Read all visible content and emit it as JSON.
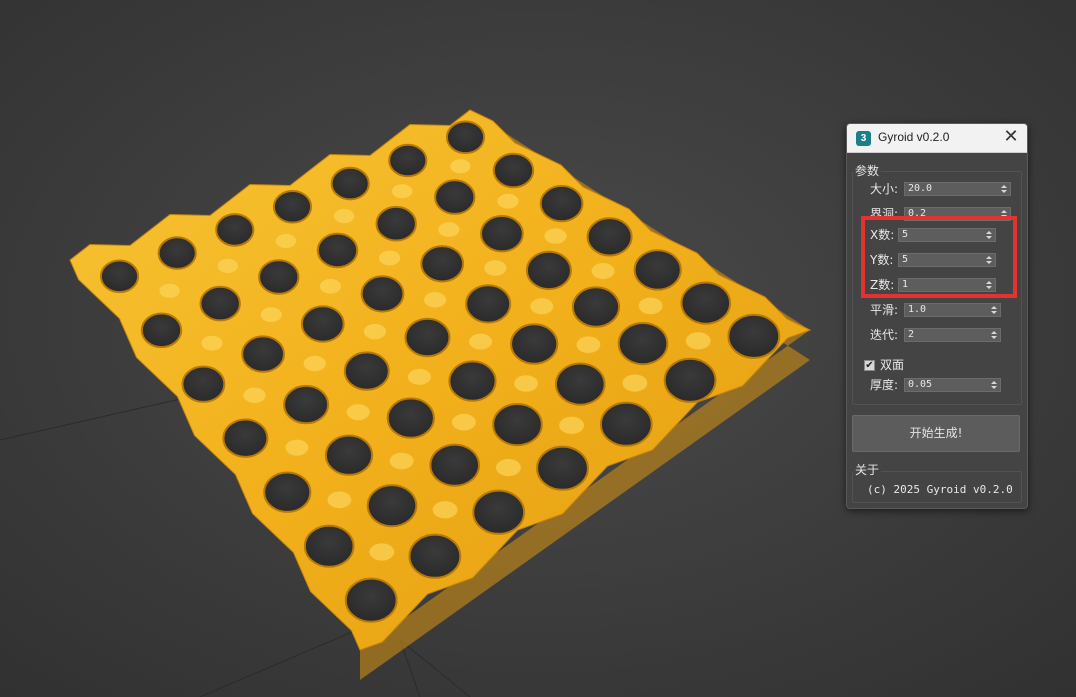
{
  "window": {
    "title": "Gyroid v0.2.0",
    "app_icon_glyph": "3",
    "close_glyph": "✕"
  },
  "params": {
    "group_label": "参数",
    "size": {
      "label": "大小:",
      "value": "20.0"
    },
    "thickness_hidden": {
      "label": "界洞:",
      "value": "0.2"
    },
    "x_count": {
      "label": "X数:",
      "value": "5"
    },
    "y_count": {
      "label": "Y数:",
      "value": "5"
    },
    "z_count": {
      "label": "Z数:",
      "value": "1"
    },
    "smooth": {
      "label": "平滑:",
      "value": "1.0"
    },
    "iterations": {
      "label": "迭代:",
      "value": "2"
    },
    "double_sided": {
      "label": "双面",
      "checked": true,
      "check_glyph": "✔"
    },
    "thickness": {
      "label": "厚度:",
      "value": "0.05"
    }
  },
  "generate_button": {
    "label": "开始生成!"
  },
  "about": {
    "group_label": "关于",
    "text": "(c) 2025 Gyroid v0.2.0"
  },
  "colors": {
    "mesh": "#f5b418",
    "background": "#3a3a3a",
    "highlight": "#e23232",
    "dialog": "#444444"
  }
}
